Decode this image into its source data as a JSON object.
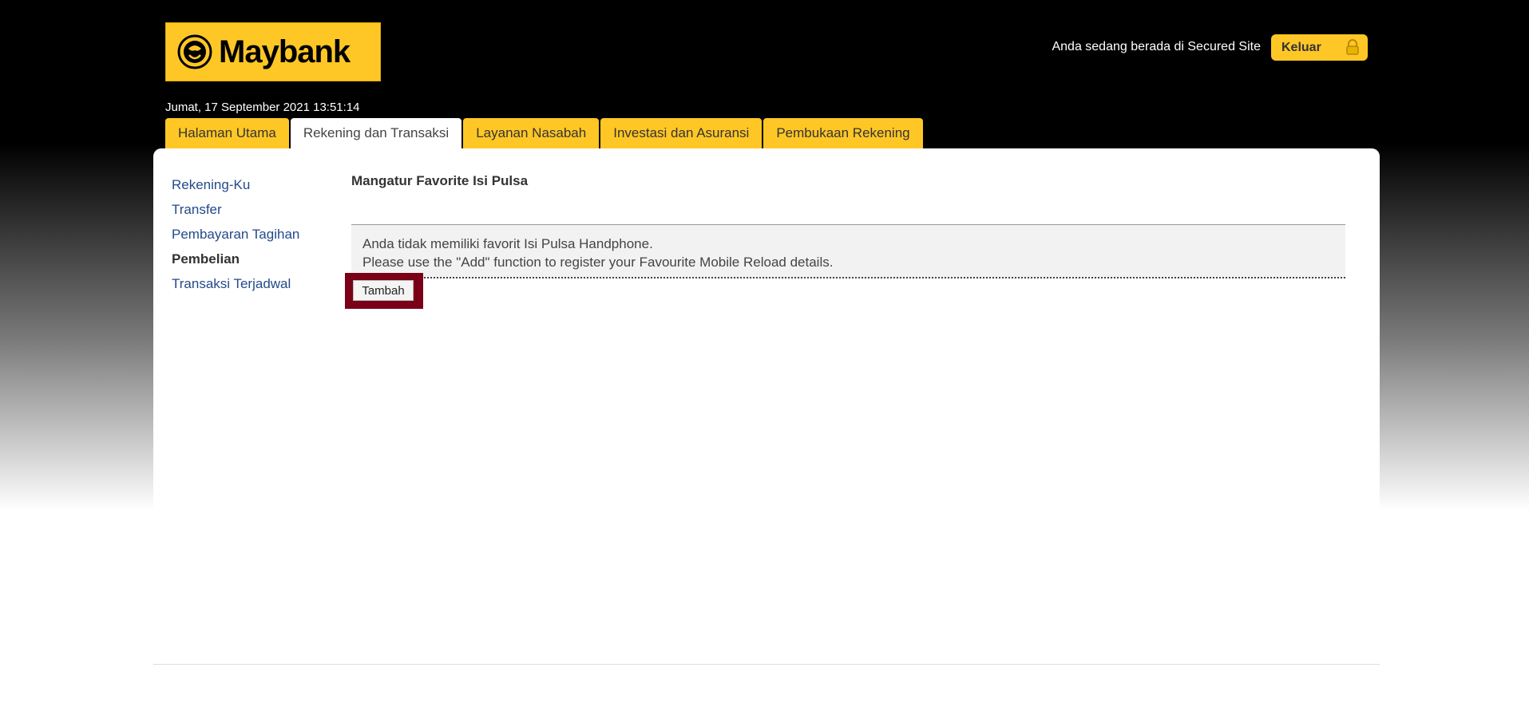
{
  "header": {
    "logo_text": "Maybank",
    "secure_text": "Anda sedang berada di Secured Site",
    "logout_label": "Keluar",
    "datetime": "Jumat, 17 September 2021 13:51:14"
  },
  "tabs": [
    {
      "label": "Halaman Utama"
    },
    {
      "label": "Rekening dan Transaksi"
    },
    {
      "label": "Layanan Nasabah"
    },
    {
      "label": "Investasi dan Asuransi"
    },
    {
      "label": "Pembukaan Rekening"
    }
  ],
  "sidebar": {
    "items": [
      {
        "label": "Rekening-Ku"
      },
      {
        "label": "Transfer"
      },
      {
        "label": "Pembayaran Tagihan"
      },
      {
        "label": "Pembelian"
      },
      {
        "label": "Transaksi Terjadwal"
      }
    ]
  },
  "main": {
    "title": "Mangatur Favorite Isi Pulsa",
    "message_line1": "Anda tidak memiliki favorit Isi Pulsa Handphone.",
    "message_line2": "Please use the \"Add\" function to register your Favourite Mobile Reload details.",
    "add_button_label": "Tambah"
  },
  "colors": {
    "brand_yellow": "#ffc726",
    "link_blue": "#244a8a",
    "highlight_frame": "#7a0018"
  }
}
